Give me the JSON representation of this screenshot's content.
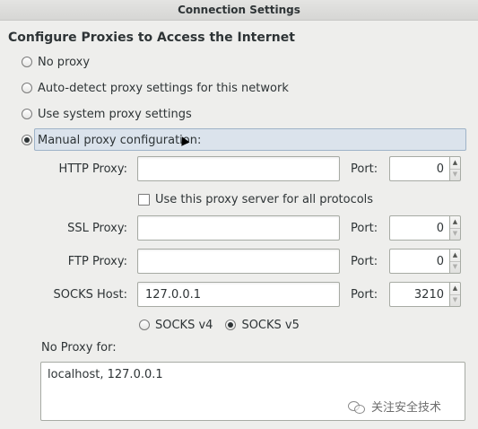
{
  "window": {
    "title": "Connection Settings"
  },
  "section_title": "Configure Proxies to Access the Internet",
  "proxy_modes": [
    {
      "label": "No proxy",
      "selected": false
    },
    {
      "label": "Auto-detect proxy settings for this network",
      "selected": false
    },
    {
      "label": "Use system proxy settings",
      "selected": false
    },
    {
      "label": "Manual proxy configuration:",
      "selected": true
    }
  ],
  "http": {
    "label": "HTTP Proxy:",
    "value": "",
    "port_label": "Port:",
    "port": "0"
  },
  "use_for_all": {
    "label": "Use this proxy server for all protocols",
    "checked": false
  },
  "ssl": {
    "label": "SSL Proxy:",
    "value": "",
    "port_label": "Port:",
    "port": "0"
  },
  "ftp": {
    "label": "FTP Proxy:",
    "value": "",
    "port_label": "Port:",
    "port": "0"
  },
  "socks": {
    "label": "SOCKS Host:",
    "value": "127.0.0.1",
    "port_label": "Port:",
    "port": "3210"
  },
  "socks_versions": [
    {
      "label": "SOCKS v4",
      "selected": false
    },
    {
      "label": "SOCKS v5",
      "selected": true
    }
  ],
  "no_proxy": {
    "label": "No Proxy for:",
    "value": "localhost, 127.0.0.1"
  },
  "watermark": "关注安全技术"
}
